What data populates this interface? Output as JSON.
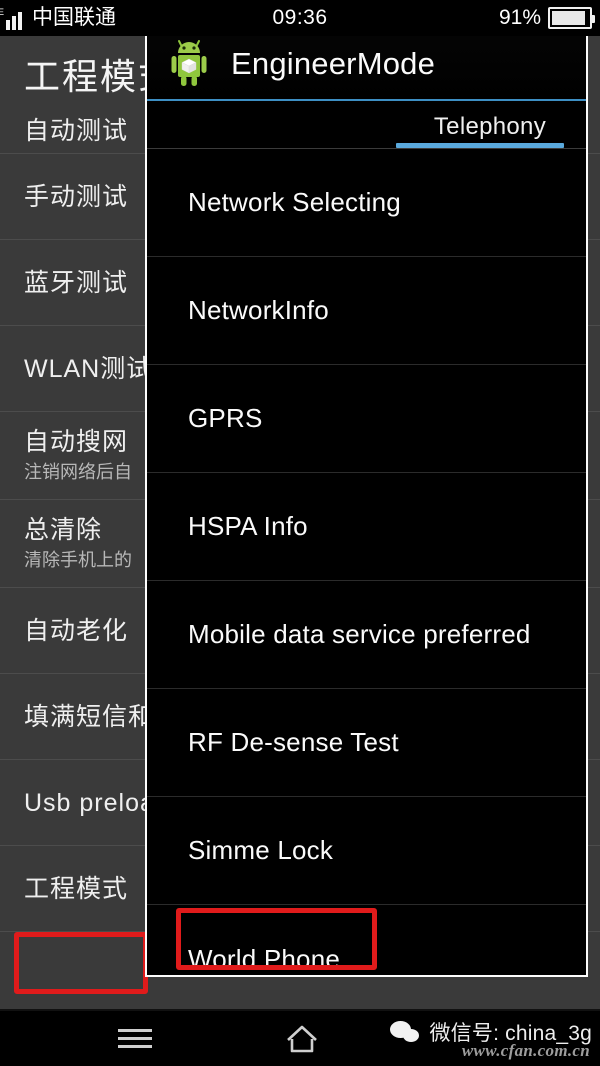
{
  "status_bar": {
    "network_type": "E",
    "carrier": "中国联通",
    "clock": "09:36",
    "battery_percent": "91%",
    "battery_level": 91
  },
  "background_activity": {
    "title": "工程模式",
    "items": [
      {
        "label": "自动测试",
        "sub": "",
        "clipped": true
      },
      {
        "label": "手动测试",
        "sub": ""
      },
      {
        "label": "蓝牙测试",
        "sub": ""
      },
      {
        "label": "WLAN测试",
        "sub": ""
      },
      {
        "label": "自动搜网",
        "sub": "注销网络后自"
      },
      {
        "label": "总清除",
        "sub": "清除手机上的"
      },
      {
        "label": "自动老化",
        "sub": ""
      },
      {
        "label": "填满短信和",
        "sub": ""
      },
      {
        "label": "Usb preloa",
        "sub": ""
      },
      {
        "label": "工程模式",
        "sub": "",
        "highlighted": true
      }
    ]
  },
  "dialog": {
    "icon": "android-robot-icon",
    "title": "EngineerMode",
    "tabs": [
      {
        "label": "Telephony",
        "active": true
      }
    ],
    "list": [
      {
        "label": "Network Selecting"
      },
      {
        "label": "NetworkInfo"
      },
      {
        "label": "GPRS"
      },
      {
        "label": "HSPA Info"
      },
      {
        "label": "Mobile data service preferred"
      },
      {
        "label": "RF De-sense Test"
      },
      {
        "label": "Simme Lock"
      },
      {
        "label": "World Phone",
        "highlighted": true
      }
    ]
  },
  "nav_bar": {
    "menu_icon": "menu-icon",
    "home_icon": "home-icon"
  },
  "watermark": {
    "wechat_label": "微信号: china_3g",
    "url": "www.cfan.com.cn"
  },
  "colors": {
    "accent_blue": "#5aa9dd",
    "highlight_red": "#e01b1b",
    "dialog_bg": "#000000",
    "background_list_bg": "#3a3a3a"
  }
}
